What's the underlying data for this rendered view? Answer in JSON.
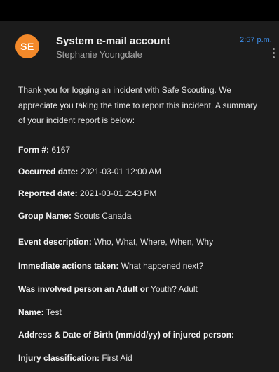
{
  "header": {
    "avatar_initials": "SE",
    "avatar_color": "#f3892a",
    "sender_name": "System e-mail account",
    "sender_subtitle": "Stephanie Youngdale",
    "timestamp": "2:57 p.m.",
    "timestamp_color": "#3d8ee9",
    "more_icon": "more-vertical-icon"
  },
  "body": {
    "intro": "Thank you for logging an incident with Safe Scouting. We appreciate you taking the time to report this incident. A summary of your incident report is below:",
    "fields": [
      {
        "label": "Form #:",
        "value": " 6167"
      },
      {
        "label": "Occurred date:",
        "value": " 2021-03-01 12:00 AM"
      },
      {
        "label": "Reported date:",
        "value": " 2021-03-01 2:43 PM"
      },
      {
        "label": "Group Name:",
        "value": " Scouts Canada"
      },
      {
        "label": "Event description:",
        "value": " Who, What, Where, When, Why"
      },
      {
        "label": "Immediate actions taken:",
        "value": " What happened next?"
      },
      {
        "label": "Was involved person an Adult or",
        "value": " Youth? Adult"
      },
      {
        "label": "Name:",
        "value": " Test"
      },
      {
        "label": "Address & Date of Birth (mm/dd/yy) of injured person:",
        "value": ""
      },
      {
        "label": "Injury classification:",
        "value": " First Aid"
      }
    ]
  }
}
